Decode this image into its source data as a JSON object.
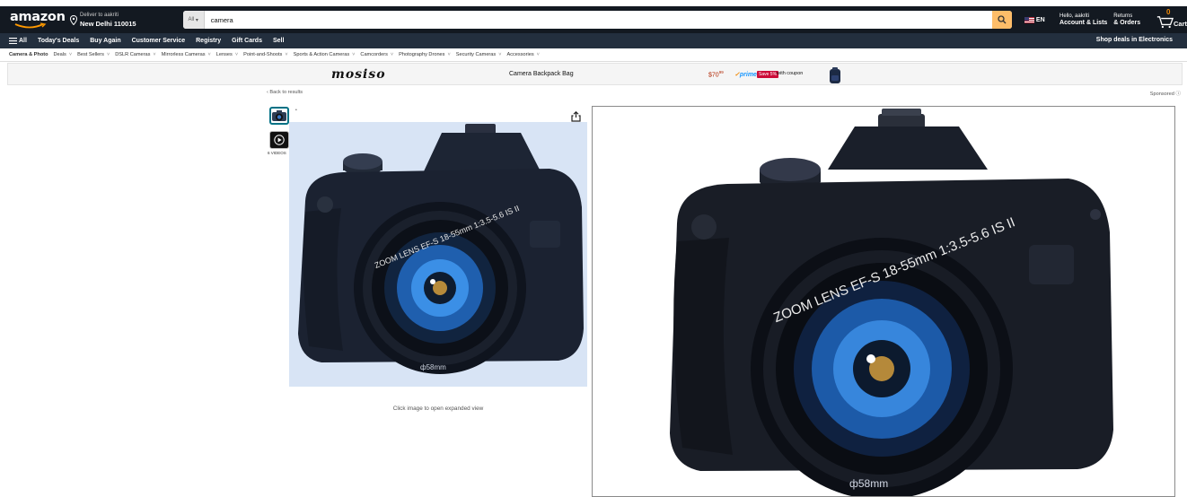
{
  "header": {
    "logo": "amazon",
    "deliver_line1": "Deliver to aakriti",
    "deliver_line2": "New Delhi 110015",
    "search_category": "All",
    "search_value": "camera",
    "language": "EN",
    "account_line1": "Hello, aakriti",
    "account_line2": "Account & Lists",
    "orders_line1": "Returns",
    "orders_line2": "& Orders",
    "cart_count": "0",
    "cart_label": "Cart"
  },
  "nav": {
    "all_label": "All",
    "items": [
      "Today's Deals",
      "Buy Again",
      "Customer Service",
      "Registry",
      "Gift Cards",
      "Sell"
    ],
    "right_label": "Shop deals in Electronics"
  },
  "subnav": {
    "items": [
      "Camera & Photo",
      "Deals",
      "Best Sellers",
      "DSLR Cameras",
      "Mirrorless Cameras",
      "Lenses",
      "Point-and-Shoots",
      "Sports & Action Cameras",
      "Camcorders",
      "Photography Drones",
      "Security Cameras",
      "Accessories"
    ]
  },
  "banner": {
    "brand": "mosiso",
    "title": "Camera Backpack Bag",
    "price": "$70",
    "price_cents": "99",
    "prime": "prime",
    "save_badge": "Save 5%",
    "coupon_text": "with coupon"
  },
  "product": {
    "back_link": "‹ Back to results",
    "sponsored": "Sponsored",
    "videos_label": "6 VIDEOS",
    "image_hint": "Click image to open expanded view",
    "camera_lens_text": "ZOOM LENS EF-S 18-55mm 1:3.5-5.6 IS II",
    "filter_size": "ф58mm"
  },
  "colors": {
    "header_bg": "#131921",
    "nav_bg": "#232f3e",
    "search_button": "#febd69",
    "cart_count": "#f08804",
    "price": "#b12704",
    "prime": "#1a98ff",
    "save_badge": "#cc0c39",
    "image_bg": "#d8e4f5"
  },
  "icons": [
    "location-pin-icon",
    "search-icon",
    "us-flag-icon",
    "cart-icon",
    "hamburger-icon",
    "share-icon",
    "play-icon",
    "backpack-icon",
    "info-icon"
  ]
}
